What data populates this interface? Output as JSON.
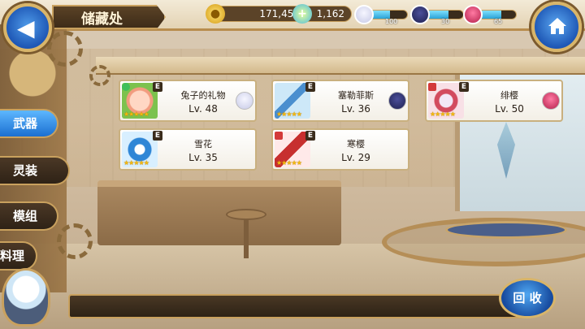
{
  "header": {
    "title": "储藏处",
    "back_icon": "back-arrow-icon",
    "home_icon": "home-icon"
  },
  "resources": {
    "gold": {
      "icon": "gold-coin-icon",
      "value": "171,451"
    },
    "gems": {
      "icon": "gem-plus-icon",
      "value": "1,162"
    }
  },
  "team": [
    {
      "name": "白发角色",
      "level": "100",
      "bar_fill": 0.55
    },
    {
      "name": "蓝发角色",
      "level": "30",
      "bar_fill": 0.6
    },
    {
      "name": "红发角色",
      "level": "65",
      "bar_fill": 0.6
    }
  ],
  "side_tabs": [
    {
      "label": "武器",
      "active": true
    },
    {
      "label": "灵装",
      "active": false
    },
    {
      "label": "模组",
      "active": false
    },
    {
      "label": "料理",
      "active": false
    }
  ],
  "items": [
    {
      "name": "兔子的礼物",
      "level": "Lv. 48",
      "grade": "E",
      "stars": "★★★★★",
      "thumb": "rabbit-gift-icon",
      "has_owner": true
    },
    {
      "name": "塞勒菲斯",
      "level": "Lv. 36",
      "grade": "E",
      "stars": "★★★★★",
      "thumb": "blue-sword-icon",
      "has_owner": true
    },
    {
      "name": "绯樱",
      "level": "Lv. 50",
      "grade": "E",
      "stars": "★★★★★",
      "thumb": "red-blade-icon",
      "has_owner": true
    },
    {
      "name": "雪花",
      "level": "Lv. 35",
      "grade": "E",
      "stars": "★★★★★",
      "thumb": "snowflake-staff-icon",
      "has_owner": false
    },
    {
      "name": "寒樱",
      "level": "Lv. 29",
      "grade": "E",
      "stars": "★★★★★",
      "thumb": "red-sword-icon",
      "has_owner": false
    }
  ],
  "footer": {
    "recycle_label": "回 收"
  }
}
